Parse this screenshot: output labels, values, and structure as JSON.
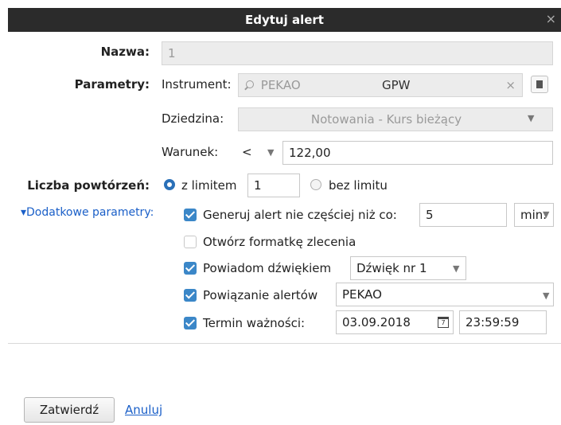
{
  "dialog": {
    "title": "Edytuj alert",
    "close_symbol": "×"
  },
  "name": {
    "label": "Nazwa:",
    "value": "1"
  },
  "parameters": {
    "label": "Parametry:",
    "instrument_label": "Instrument:",
    "instrument_value": "PEKAO",
    "instrument_market": "GPW",
    "instrument_clear": "×",
    "domain_label": "Dziedzina:",
    "domain_value": "Notowania - Kurs bieżący",
    "condition_label": "Warunek:",
    "condition_operator": "<",
    "condition_value": "122,00"
  },
  "repeats": {
    "label": "Liczba powtórzeń:",
    "with_limit_label": "z limitem",
    "limit_value": "1",
    "no_limit_label": "bez limitu"
  },
  "extra": {
    "toggle_label": "▾Dodatkowe parametry:",
    "generate_label": "Generuj alert nie częściej niż co:",
    "generate_value": "5",
    "generate_unit": "min.",
    "open_form_label": "Otwórz formatkę zlecenia",
    "sound_label": "Powiadom dźwiękiem",
    "sound_value": "Dźwięk nr 1",
    "link_label": "Powiązanie alertów",
    "link_value": "PEKAO",
    "expiry_label": "Termin ważności:",
    "expiry_date": "03.09.2018",
    "expiry_time": "23:59:59"
  },
  "footer": {
    "confirm_label": "Zatwierdź",
    "cancel_label": "Anuluj"
  },
  "colors": {
    "titlebar": "#2b2b2b",
    "accent": "#3b87c8",
    "link": "#1a5fc8"
  }
}
